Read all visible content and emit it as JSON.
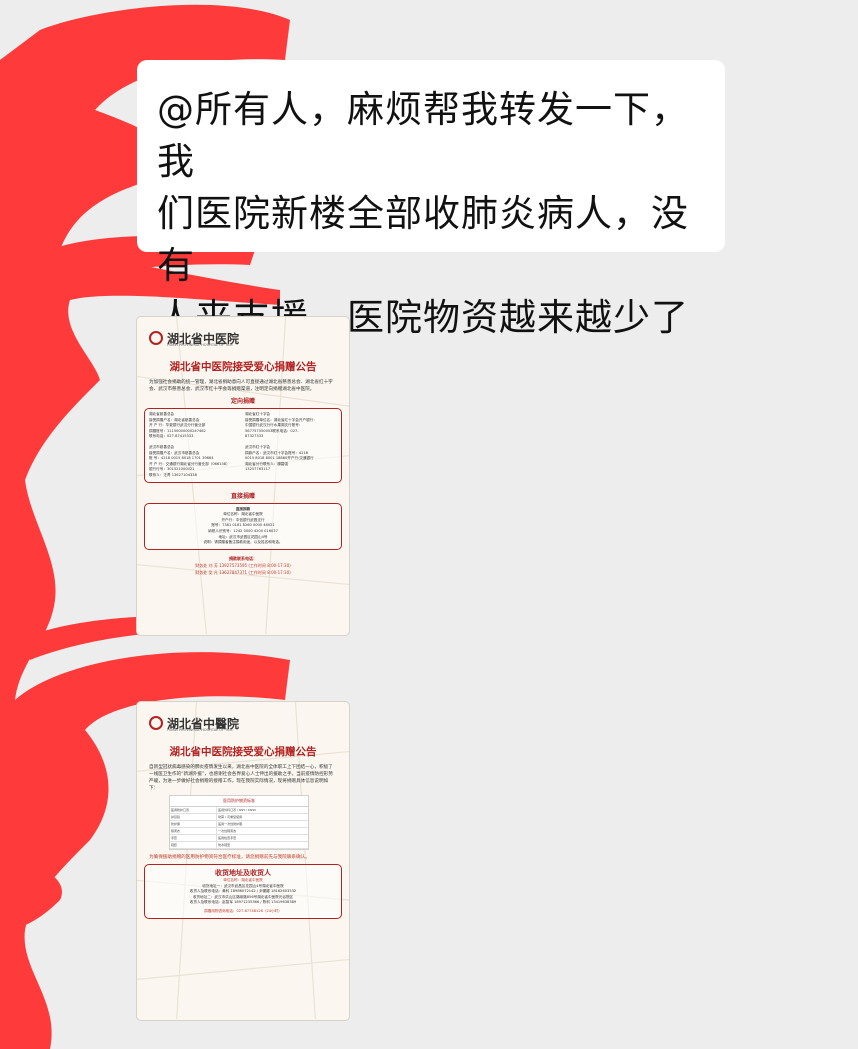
{
  "chat": {
    "message_lines": [
      "@所有人，麻烦帮我转发一下，我",
      "们医院新楼全部收肺炎病人，没有",
      "人来支援，医院物资越来越少了"
    ]
  },
  "card1": {
    "logo": "湖北省中医院",
    "logo_sub": "HUBEI PROVINCIAL HOSPITAL OF TCM",
    "title": "湖北省中医院接受爱心捐赠公告",
    "intro": "为加强社会捐助的统一管理，湖北省捐助意向人可直接通过湖北省慈善总会、湖北省红十字会、武汉市慈善总会、武汉市红十字会等捐赠渠道，注明定向捐赠湖北省中医院。",
    "directed_title": "定向捐赠",
    "org1": [
      "湖北省慈善总会",
      "接受捐赠户名：湖北省慈善总会",
      "开 户 行：华夏银行武汉分行营业部",
      "捐赠账号：11150000000247462",
      "联系电话：027-87415333"
    ],
    "org2": [
      "湖北省红十字会",
      "接受捐赠单位名：湖北省红十字会开户银行：",
      "中国银行武汉分行水果湖支行账号：",
      "567757550053联系电话：027-",
      "87327333"
    ],
    "org3": [
      "武汉市慈善总会",
      "接受捐赠户名：武汉市慈善总会",
      "账 号：4218 0015 8018 1701 39664",
      "开 户 行：交通银行湖北省分行营业部（066158）",
      "银行行号：301521000021",
      "联系人：汪青 13627104338"
    ],
    "org4": [
      "武汉市红十字会",
      "捐款户名：武汉市红十字会账号：4218",
      "0015 8018 8001 18860开户行:交通银行",
      "湖北省分行联系人：滕碧强",
      "13257763117"
    ],
    "direct_title": "直接捐赠",
    "direct_lines": [
      "直接捐款",
      "单位名称：湖北省中医院",
      "开户行：中信银行武昌支行",
      "账号：7381 0181 8260 0000 48021",
      "纳税人识别号：1242 0000 4200 016037",
      "地址：武汉市武昌区花园山4号",
      "说明：请捐赠者备注捐款用途，以及姓名和电话。"
    ],
    "contact_title": "捐款联系电话：",
    "contact_lines": [
      "财务处 刘 芳 13927573595 (工作时间 8:00-17:30)",
      "财务处 吴 凡 13627847371 (工作时间 8:00-17:30)"
    ]
  },
  "card2": {
    "logo": "湖北省中醫院",
    "logo_sub": "HUBEI PROVINCIAL HOSPITAL OF TCM",
    "title": "湖北省中医院接受爱心捐赠公告",
    "intro": "自新型冠状病毒感染的肺炎疫情发生以来，湖北省中医院的全体职工上下团结一心，积极了一线医卫生作的“新湖外援”，也感谢社会各界爱心人士伸出的援助之手。当前疫情防控形势严峻，为进一步做好社会捐赠的接赠工作，现在我院实际情况，现将捐赠具体信息说明如下：",
    "table_title": "医用防护物资标准",
    "table_rows": [
      [
        "医用防护口罩",
        "医用外科口罩 / N95 / KN95"
      ],
      [
        "护目镜",
        "防雾 / 可重复使用"
      ],
      [
        "防护服",
        "医用一次性防护服"
      ],
      [
        "隔离衣",
        "一次性隔离衣"
      ],
      [
        "手套",
        "医用检查手套"
      ],
      [
        "鞋套",
        "防水鞋套"
      ]
    ],
    "notice": "为确保援助捐赠的医用防护物资符合医疗标准，请您捐赠前先与我院联系确认。",
    "recv_title": "收货地址及收货人",
    "recv_lines": [
      "单位名称：湖北省中医院",
      "收货地址一：武汉市武昌区花园山4号湖北省中医院",
      "收货人及联系电话：黄科 18986072142 / 尹娜娜 18162603532",
      "收货地址二：武汉市洪山区珞喻路856号湖北省中医院光谷院区",
      "收货人及联系电话：赵智军 18971235366 / 陈科 13419638389"
    ],
    "hotline": "捐赠用物咨询电话：027-87748126（24小时）"
  },
  "colors": {
    "scribble": "#ff3a3a",
    "accent_red": "#b22222"
  }
}
